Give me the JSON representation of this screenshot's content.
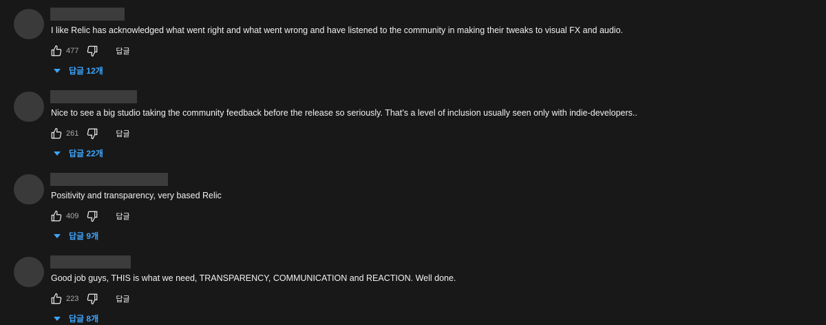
{
  "comments": [
    {
      "text": "I like Relic has acknowledged what went right and what went wrong and have listened to the community in making their tweaks to visual FX and audio.",
      "likes": "477",
      "reply_label": "답글",
      "replies_label": "답글 12개"
    },
    {
      "text": "Nice to see a big studio taking the community feedback before the release so seriously. That’s a level of inclusion usually seen only with indie-developers..",
      "likes": "261",
      "reply_label": "답글",
      "replies_label": "답글 22개"
    },
    {
      "text": "Positivity and transparency, very based Relic",
      "likes": "409",
      "reply_label": "답글",
      "replies_label": "답글 9개"
    },
    {
      "text": "Good job guys, THIS is what we need, TRANSPARENCY, COMMUNICATION and REACTION. Well done.",
      "likes": "223",
      "reply_label": "답글",
      "replies_label": "답글 8개"
    }
  ],
  "icons": {
    "like": "thumbs-up-icon",
    "dislike": "thumbs-down-icon",
    "expand": "caret-down-icon"
  },
  "colors": {
    "background": "#181818",
    "text": "#f1f1f1",
    "secondary_text": "#aaaaaa",
    "link": "#3ea6ff",
    "placeholder": "#3c3c3c"
  }
}
